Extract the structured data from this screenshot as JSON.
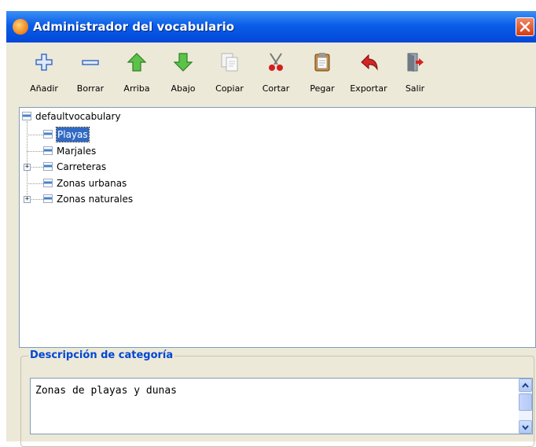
{
  "window": {
    "title": "Administrador del vocabulario"
  },
  "toolbar": {
    "buttons": [
      {
        "label": "Añadir",
        "icon": "plus-icon"
      },
      {
        "label": "Borrar",
        "icon": "minus-icon"
      },
      {
        "label": "Arriba",
        "icon": "arrow-up-icon"
      },
      {
        "label": "Abajo",
        "icon": "arrow-down-icon"
      },
      {
        "label": "Copiar",
        "icon": "copy-icon"
      },
      {
        "label": "Cortar",
        "icon": "scissors-icon"
      },
      {
        "label": "Pegar",
        "icon": "clipboard-icon"
      },
      {
        "label": "Exportar",
        "icon": "export-icon"
      },
      {
        "label": "Salir",
        "icon": "exit-door-icon"
      }
    ]
  },
  "tree": {
    "root": "defaultvocabulary",
    "items": [
      {
        "label": "Playas",
        "selected": true,
        "expandable": false
      },
      {
        "label": "Marjales",
        "selected": false,
        "expandable": false
      },
      {
        "label": "Carreteras",
        "selected": false,
        "expandable": true
      },
      {
        "label": "Zonas urbanas",
        "selected": false,
        "expandable": false
      },
      {
        "label": "Zonas naturales",
        "selected": false,
        "expandable": true
      }
    ]
  },
  "description": {
    "group_title": "Descripción de categoría",
    "text": "Zonas de playas y dunas"
  },
  "colors": {
    "titlebar": "#0a5ee8",
    "window_bg": "#ece9d8",
    "selection": "#316ac5",
    "group_title": "#0046d5"
  }
}
